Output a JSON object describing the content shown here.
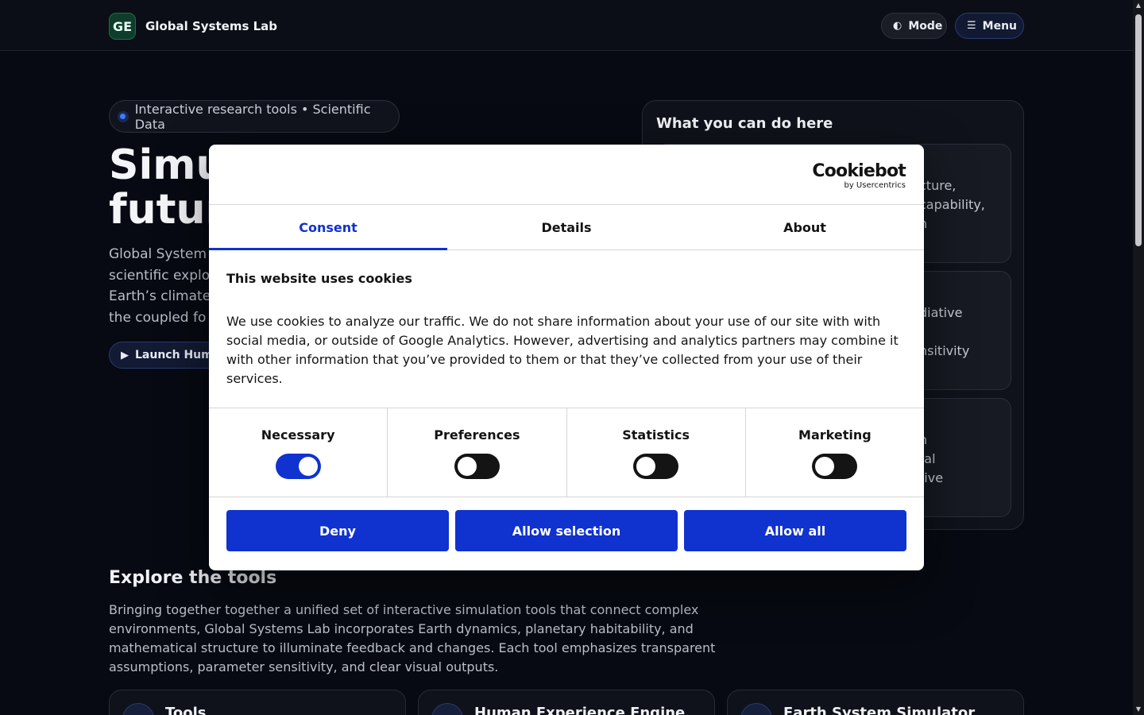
{
  "header": {
    "logo_text": "GE",
    "brand": "Global Systems Lab",
    "mode_icon": "◐",
    "mode_label": "Mode",
    "menu_icon": "☰",
    "menu_label": "Menu"
  },
  "hero": {
    "pill": "Interactive research tools • Scientific Data",
    "title_line1": "Simu",
    "title_line2": "futur",
    "desc_line1": "Global System",
    "desc_line2": "scientific explo",
    "desc_line3": "Earth’s climate",
    "desc_line4": "the coupled fo",
    "launch_icon": "▶",
    "launch_label": "Launch Huma"
  },
  "side_card": {
    "title": "What you can do here",
    "features": [
      {
        "lines": [
          "cture,",
          "capability,",
          "n"
        ]
      },
      {
        "lines": [
          "diative",
          "",
          "nsitivity"
        ]
      },
      {
        "lines": [
          "n",
          "tal",
          "tive"
        ]
      }
    ]
  },
  "explore": {
    "title": "Explore the tools",
    "desc": "Bringing together together a unified set of interactive simulation tools that connect complex environments, Global Systems Lab incorporates Earth dynamics, planetary habitability, and mathematical structure to illuminate feedback and changes. Each tool emphasizes transparent assumptions, parameter sensitivity, and clear visual outputs.",
    "tools": [
      {
        "title": "Tools",
        "icon": "□"
      },
      {
        "title": "Human Experience Engine",
        "icon": "□"
      },
      {
        "title": "Earth System Simulator",
        "icon": "□"
      }
    ]
  },
  "cookie_dialog": {
    "logo_main": "Cookiebot",
    "logo_sub": "by Usercentrics",
    "tabs": [
      "Consent",
      "Details",
      "About"
    ],
    "heading": "This website uses cookies",
    "body": "We use cookies to analyze our traffic. We do not share information about your use of our site with with social media, or outside of Google Analytics. However, advertising and analytics partners may combine it with other information that you’ve provided to them or that they’ve collected from your use of their services.",
    "categories": [
      {
        "label": "Necessary",
        "enabled": true
      },
      {
        "label": "Preferences",
        "enabled": false
      },
      {
        "label": "Statistics",
        "enabled": false
      },
      {
        "label": "Marketing",
        "enabled": false
      }
    ],
    "buttons": {
      "deny": "Deny",
      "allow_selection": "Allow selection",
      "allow_all": "Allow all"
    }
  },
  "colors": {
    "accent": "#1032cf",
    "background": "#070a12"
  }
}
